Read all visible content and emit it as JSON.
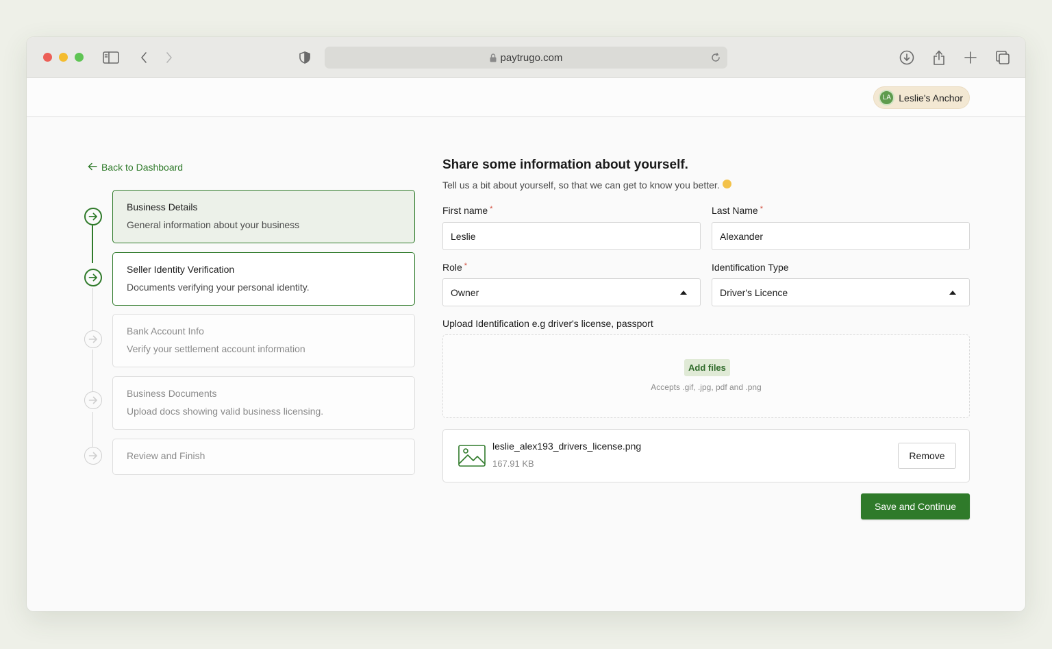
{
  "browser": {
    "url": "paytrugo.com"
  },
  "header": {
    "user_initials": "LA",
    "user_name": "Leslie's Anchor"
  },
  "nav": {
    "back_label": "Back to Dashboard"
  },
  "steps": [
    {
      "title": "Business Details",
      "description": "General information about your business",
      "state": "current"
    },
    {
      "title": "Seller Identity Verification",
      "description": "Documents verifying your personal identity.",
      "state": "done"
    },
    {
      "title": "Bank Account Info",
      "description": "Verify your settlement account information",
      "state": "pending"
    },
    {
      "title": "Business Documents",
      "description": "Upload docs showing valid business licensing.",
      "state": "pending"
    },
    {
      "title": "Review and Finish",
      "description": "",
      "state": "pending"
    }
  ],
  "form": {
    "title": "Share some information about yourself.",
    "subtitle": "Tell us a bit about yourself, so that we can get to know you better.",
    "first_name": {
      "label": "First name",
      "required_mark": "*",
      "value": "Leslie"
    },
    "last_name": {
      "label": "Last Name",
      "required_mark": "*",
      "value": "Alexander"
    },
    "role": {
      "label": "Role",
      "required_mark": "*",
      "value": "Owner"
    },
    "id_type": {
      "label": "Identification Type",
      "value": "Driver's Licence"
    },
    "upload": {
      "label": "Upload Identification e.g driver's license, passport",
      "add_files_label": "Add files",
      "accepts_text": "Accepts .gif, .jpg, pdf and .png"
    },
    "file": {
      "name": "leslie_alex193_drivers_license.png",
      "size": "167.91 KB",
      "remove_label": "Remove"
    },
    "submit_label": "Save and Continue"
  },
  "colors": {
    "accent": "#2f7a2a",
    "current_step_bg": "#ecf1e9",
    "user_chip_bg": "#f3e8d3",
    "avatar_bg": "#5e9b4d"
  }
}
